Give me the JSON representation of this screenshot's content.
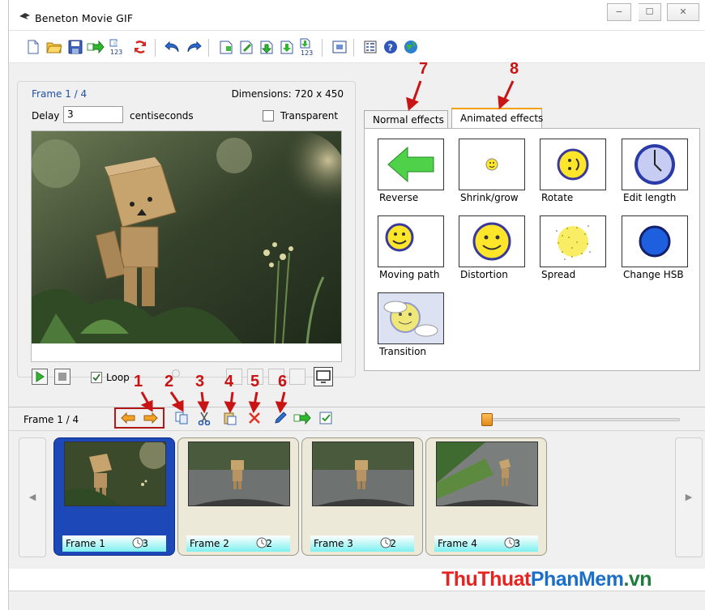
{
  "window": {
    "title": "Beneton Movie GIF",
    "minimize": "−",
    "maximize": "☐",
    "close": "✕"
  },
  "toolbar": {
    "icons": [
      "new-file-icon",
      "open-folder-icon",
      "save-icon",
      "export-icon",
      "numbered-export-icon",
      "refresh-icon",
      "undo-icon",
      "redo-icon",
      "insert-frame-icon",
      "edit-frame-icon",
      "import-frame-icon",
      "save-frame-icon",
      "numbered-frames-icon",
      "resize-icon",
      "properties-icon",
      "help-icon",
      "globe-icon"
    ],
    "badge_123": "123"
  },
  "frame_panel": {
    "frame_label": "Frame 1 / 4",
    "dimensions": "Dimensions: 720 x 450",
    "delay_label": "Delay",
    "delay_value": "3",
    "delay_unit": "centiseconds",
    "transparent_label": "Transparent",
    "transparent_checked": false,
    "loop_label": "Loop",
    "loop_checked": true
  },
  "effects": {
    "tabs": [
      {
        "label": "Normal effects",
        "active": false
      },
      {
        "label": "Animated effects",
        "active": true
      }
    ],
    "items": [
      {
        "label": "Reverse",
        "icon": "left-arrow-icon"
      },
      {
        "label": "Shrink/grow",
        "icon": "small-smiley-icon"
      },
      {
        "label": "Rotate",
        "icon": "rotate-smiley-icon"
      },
      {
        "label": "Edit length",
        "icon": "clock-icon"
      },
      {
        "label": "Moving path",
        "icon": "smiley-path-icon"
      },
      {
        "label": "Distortion",
        "icon": "smiley-distortion-icon"
      },
      {
        "label": "Spread",
        "icon": "spread-dots-icon"
      },
      {
        "label": "Change HSB",
        "icon": "blue-circle-icon"
      },
      {
        "label": "Transition",
        "icon": "transition-cloud-icon"
      }
    ]
  },
  "strip": {
    "frame_label": "Frame 1 / 4",
    "frames": [
      {
        "label": "Frame 1",
        "delay": "3",
        "selected": true
      },
      {
        "label": "Frame 2",
        "delay": "2",
        "selected": false
      },
      {
        "label": "Frame 3",
        "delay": "2",
        "selected": false
      },
      {
        "label": "Frame 4",
        "delay": "3",
        "selected": false
      }
    ],
    "scroll_left": "◀",
    "scroll_right": "▶"
  },
  "annotations": [
    "1",
    "2",
    "3",
    "4",
    "5",
    "6",
    "7",
    "8"
  ],
  "watermark": {
    "part1": "ThuThuat",
    "part2": "PhanMem",
    "part3": ".vn"
  }
}
